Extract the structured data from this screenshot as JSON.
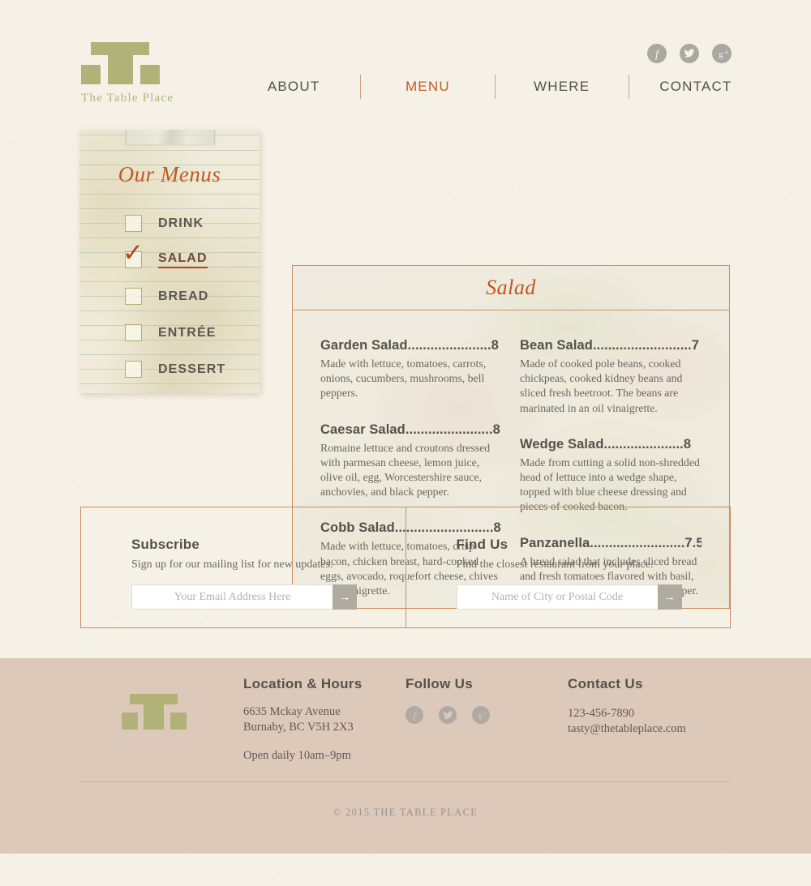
{
  "brand": {
    "name": "The Table Place",
    "logo_color": "#b1b277"
  },
  "header": {
    "nav": [
      {
        "label": "ABOUT",
        "active": false
      },
      {
        "label": "MENU",
        "active": true
      },
      {
        "label": "WHERE",
        "active": false
      },
      {
        "label": "CONTACT",
        "active": false
      }
    ],
    "social": [
      {
        "name": "facebook-icon",
        "glyph": "f"
      },
      {
        "name": "twitter-icon",
        "glyph": "t"
      },
      {
        "name": "google-plus-icon",
        "glyph": "g+"
      }
    ]
  },
  "sidebar": {
    "title": "Our Menus",
    "items": [
      {
        "label": "DRINK",
        "checked": false
      },
      {
        "label": "SALAD",
        "checked": true
      },
      {
        "label": "BREAD",
        "checked": false
      },
      {
        "label": "ENTRÉE",
        "checked": false
      },
      {
        "label": "DESSERT",
        "checked": false
      }
    ],
    "check_glyph": "✓"
  },
  "menu_card": {
    "title": "Salad",
    "left_column": [
      {
        "name": "Garden Salad",
        "dots": "......................",
        "price": "8",
        "heading": "Garden Salad......................8",
        "description": "Made with lettuce, tomatoes, carrots, onions, cucumbers, mushrooms, bell peppers."
      },
      {
        "name": "Caesar Salad",
        "dots": ".......................",
        "price": "8",
        "heading": "Caesar Salad.......................8",
        "description": "Romaine lettuce and croutons dressed with parmesan cheese, lemon juice, olive oil, egg, Worcestershire sauce, anchovies, and black pepper."
      },
      {
        "name": "Cobb Salad",
        "dots": "..........................",
        "price": "8",
        "heading": "Cobb Salad..........................8",
        "description": "Made with lettuce, tomatoes, crisp bacon, chicken breast, hard-cooked eggs, avocado, roquefort cheese, chives and vinaigrette."
      }
    ],
    "right_column": [
      {
        "name": "Bean Salad",
        "dots": "..........................",
        "price": "7",
        "heading": "Bean Salad..........................7",
        "description": "Made of cooked pole beans, cooked chickpeas, cooked kidney beans and sliced fresh beetroot. The beans are marinated in an oil vinaigrette."
      },
      {
        "name": "Wedge Salad",
        "dots": ".....................",
        "price": "8",
        "heading": "Wedge Salad.....................8",
        "description": "Made from cutting a solid non-shredded head of lettuce into a wedge shape, topped with blue cheese dressing and pieces of cooked bacon."
      },
      {
        "name": "Panzanella",
        "dots": ".........................",
        "price": "7.5",
        "heading": "Panzanella.........................7.5",
        "description": "A bread salad that includes sliced bread and fresh tomatoes flavored with basil, olive oil, vinegar, salt and black pepper."
      }
    ]
  },
  "subscribe": {
    "heading": "Subscribe",
    "subtext": "Sign up for our mailing list for new updates.",
    "placeholder": "Your Email Address Here",
    "value": "",
    "submit_glyph": "→"
  },
  "find_us": {
    "heading": "Find Us",
    "subtext": "Find the closest restaurant from your place.",
    "placeholder": "Name of City or Postal Code",
    "value": "",
    "submit_glyph": "→"
  },
  "footer": {
    "location": {
      "heading": "Location & Hours",
      "address_line1": "6635 Mckay Avenue",
      "address_line2": "Burnaby, BC V5H 2X3",
      "hours": "Open daily 10am–9pm"
    },
    "follow": {
      "heading": "Follow Us",
      "social": [
        {
          "name": "facebook-icon",
          "glyph": "f"
        },
        {
          "name": "twitter-icon",
          "glyph": "t"
        },
        {
          "name": "google-plus-icon",
          "glyph": "g+"
        }
      ]
    },
    "contact": {
      "heading": "Contact Us",
      "phone": "123-456-7890",
      "email": "tasty@thetableplace.com"
    },
    "copyright": "© 2015 THE TABLE PLACE"
  },
  "colors": {
    "page_bg": "#f6f1e7",
    "accent_orange": "#c15a22",
    "border_tan": "#c98f62",
    "olive": "#b1b277",
    "footer_bg": "#ddc9ba",
    "text_dark": "#55514a"
  }
}
